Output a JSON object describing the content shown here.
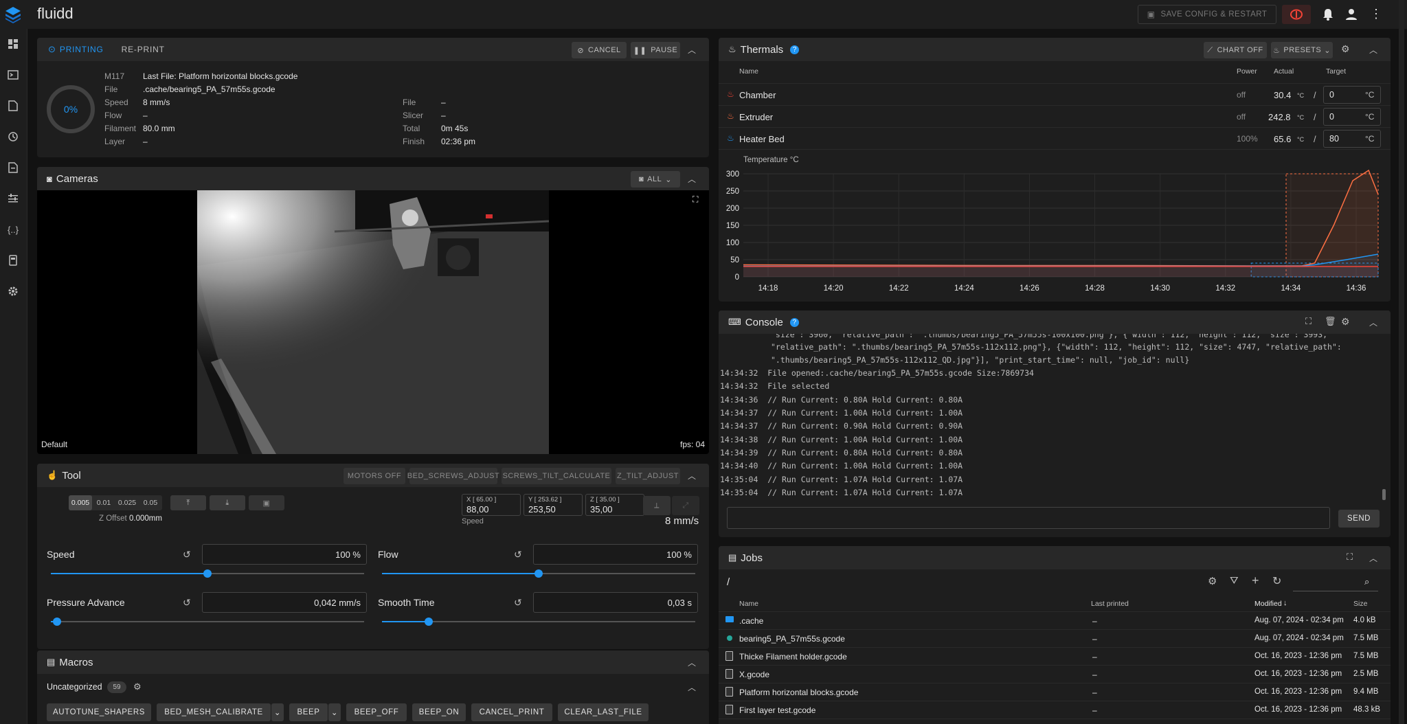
{
  "app": {
    "title": "fluidd",
    "save_restart_label": "SAVE CONFIG & RESTART"
  },
  "status": {
    "tabs": [
      "PRINTING",
      "RE-PRINT"
    ],
    "cancel_label": "CANCEL",
    "pause_label": "PAUSE",
    "progress": "0%",
    "m117_label": "M117",
    "m117_value": "Last File: Platform horizontal blocks.gcode",
    "left": [
      {
        "label": "File",
        "value": ".cache/bearing5_PA_57m55s.gcode"
      },
      {
        "label": "Speed",
        "value": "8 mm/s"
      },
      {
        "label": "Flow",
        "value": "–"
      },
      {
        "label": "Filament",
        "value": "80.0 mm"
      },
      {
        "label": "Layer",
        "value": "–"
      }
    ],
    "right": [
      {
        "label": "File",
        "value": "–"
      },
      {
        "label": "Slicer",
        "value": "–"
      },
      {
        "label": "Total",
        "value": "0m 45s"
      },
      {
        "label": "Finish",
        "value": "02:36 pm"
      }
    ]
  },
  "cameras": {
    "title": "Cameras",
    "all_label": "ALL",
    "camera_name": "Default",
    "fps": "fps: 04"
  },
  "tool": {
    "title": "Tool",
    "buttons": [
      "MOTORS OFF",
      "BED_SCREWS_ADJUST",
      "SCREWS_TILT_CALCULATE",
      "Z_TILT_ADJUST"
    ],
    "zsteps": [
      "0.005",
      "0.01",
      "0.025",
      "0.05"
    ],
    "zoffset_label": "Z Offset",
    "zoffset_value": "0.000mm",
    "axes": [
      {
        "label": "X [ 65.00 ]",
        "value": "88,00"
      },
      {
        "label": "Y [ 253.62 ]",
        "value": "253,50"
      },
      {
        "label": "Z [ 35.00 ]",
        "value": "35,00"
      }
    ],
    "speed_label": "Speed",
    "speed_value": "8 mm/s",
    "sliders": [
      {
        "label": "Speed",
        "value": "100 %",
        "level": 0.5
      },
      {
        "label": "Flow",
        "value": "100 %",
        "level": 0.5
      },
      {
        "label": "Pressure Advance",
        "value": "0,042 mm/s",
        "level": 0.02
      },
      {
        "label": "Smooth Time",
        "value": "0,03 s",
        "level": 0.15
      }
    ]
  },
  "macros": {
    "title": "Macros",
    "group": "Uncategorized",
    "count": "59",
    "items": [
      "AUTOTUNE_SHAPERS",
      "BED_MESH_CALIBRATE",
      "BEEP",
      "BEEP_OFF",
      "BEEP_ON",
      "CANCEL_PRINT",
      "CLEAR_LAST_FILE"
    ]
  },
  "thermals": {
    "title": "Thermals",
    "chart_off_label": "CHART OFF",
    "presets_label": "PRESETS",
    "headers": {
      "name": "Name",
      "power": "Power",
      "actual": "Actual",
      "target": "Target"
    },
    "rows": [
      {
        "name": "Chamber",
        "power": "off",
        "actual": "30.4",
        "target": "0",
        "color": "#f44336"
      },
      {
        "name": "Extruder",
        "power": "off",
        "actual": "242.8",
        "target": "0",
        "color": "#ff7043"
      },
      {
        "name": "Heater Bed",
        "power": "100%",
        "actual": "65.6",
        "target": "80",
        "color": "#2196f3"
      }
    ],
    "unit": "°C",
    "slash": "/"
  },
  "chart_data": {
    "type": "line",
    "ylabel": "Temperature °C",
    "ylim": [
      0,
      300
    ],
    "yticks": [
      0,
      50,
      100,
      150,
      200,
      250,
      300
    ],
    "xticks": [
      "14:18",
      "14:20",
      "14:22",
      "14:24",
      "14:26",
      "14:28",
      "14:30",
      "14:32",
      "14:34",
      "14:36"
    ],
    "x": [
      14.3,
      14.31,
      14.32,
      14.33,
      14.34,
      14.35,
      14.36,
      14.37,
      14.38,
      14.39,
      14.4
    ],
    "series": [
      {
        "color": "#ff7043",
        "x": [
          0,
          0.2,
          0.4,
          0.6,
          0.8,
          0.88,
          0.9,
          0.93,
          0.96,
          0.985,
          1.0
        ],
        "values": [
          35,
          34,
          33,
          33,
          32,
          32,
          40,
          150,
          280,
          310,
          240
        ]
      },
      {
        "color": "#2196f3",
        "x": [
          0,
          0.2,
          0.4,
          0.6,
          0.8,
          0.88,
          0.9,
          0.95,
          1.0
        ],
        "values": [
          31,
          31,
          31,
          31,
          31,
          31,
          35,
          50,
          66
        ]
      },
      {
        "color": "#f44336",
        "x": [
          0,
          0.5,
          1.0
        ],
        "values": [
          30,
          30,
          30
        ]
      }
    ]
  },
  "console": {
    "title": "Console",
    "send_label": "SEND",
    "lines": [
      "\"size\": 3960, \"relative_path\": \".thumbs/bearing5_PA_57m55s-100x100.png\"}, {\"width\": 112, \"height\": 112, \"size\": 3993,",
      "\"relative_path\": \".thumbs/bearing5_PA_57m55s-112x112.png\"}, {\"width\": 112, \"height\": 112, \"size\": 4747, \"relative_path\":",
      "\".thumbs/bearing5_PA_57m55s-112x112_QD.jpg\"}], \"print_start_time\": null, \"job_id\": null}",
      "14:34:32  File opened:.cache/bearing5_PA_57m55s.gcode Size:7869734",
      "14:34:32  File selected",
      "14:34:36  // Run Current: 0.80A Hold Current: 0.80A",
      "14:34:37  // Run Current: 1.00A Hold Current: 1.00A",
      "14:34:37  // Run Current: 0.90A Hold Current: 0.90A",
      "14:34:38  // Run Current: 1.00A Hold Current: 1.00A",
      "14:34:39  // Run Current: 0.80A Hold Current: 0.80A",
      "14:34:40  // Run Current: 1.00A Hold Current: 1.00A",
      "14:35:04  // Run Current: 1.07A Hold Current: 1.07A",
      "14:35:04  // Run Current: 1.07A Hold Current: 1.07A"
    ]
  },
  "jobs": {
    "title": "Jobs",
    "path": "/",
    "headers": {
      "name": "Name",
      "last_printed": "Last printed",
      "modified": "Modified",
      "size": "Size"
    },
    "rows": [
      {
        "name": ".cache",
        "last": "–",
        "modified": "Aug. 07, 2024 - 02:34 pm",
        "size": "4.0 kB",
        "icon": "folder"
      },
      {
        "name": "bearing5_PA_57m55s.gcode",
        "last": "–",
        "modified": "Aug. 07, 2024 - 02:34 pm",
        "size": "7.5 MB",
        "icon": "dot"
      },
      {
        "name": "Thicke Filament holder.gcode",
        "last": "–",
        "modified": "Oct. 16, 2023 - 12:36 pm",
        "size": "7.5 MB",
        "icon": "file"
      },
      {
        "name": "X.gcode",
        "last": "–",
        "modified": "Oct. 16, 2023 - 12:36 pm",
        "size": "2.5 MB",
        "icon": "file"
      },
      {
        "name": "Platform horizontal blocks.gcode",
        "last": "–",
        "modified": "Oct. 16, 2023 - 12:36 pm",
        "size": "9.4 MB",
        "icon": "file"
      },
      {
        "name": "First layer test.gcode",
        "last": "–",
        "modified": "Oct. 16, 2023 - 12:36 pm",
        "size": "48.3 kB",
        "icon": "file"
      }
    ]
  }
}
